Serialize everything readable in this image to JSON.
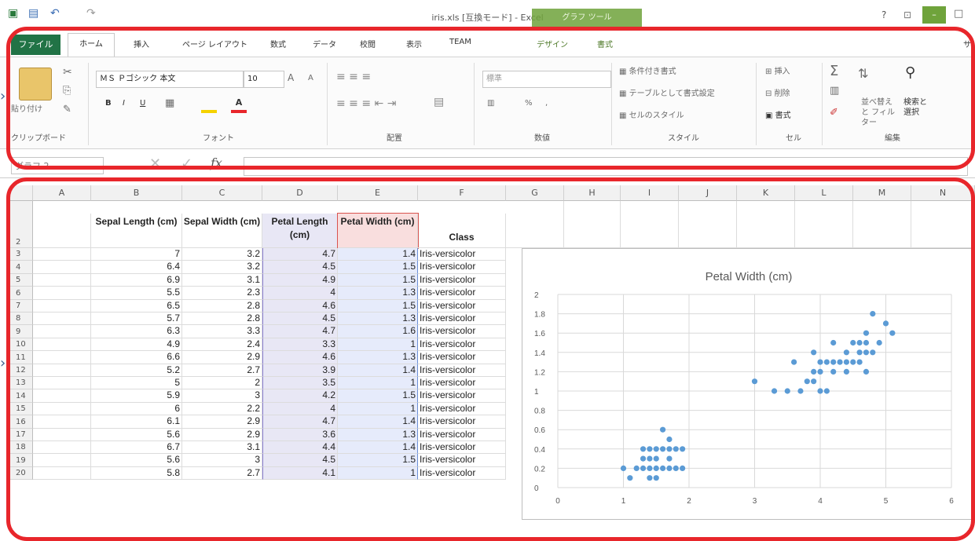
{
  "window": {
    "title": "iris.xls [互換モード] - Excel",
    "context_tab": "グラフ ツール",
    "help_label": "?"
  },
  "tabs": [
    "ファイル",
    "ホーム",
    "挿入",
    "ページ レイアウト",
    "数式",
    "データ",
    "校閲",
    "表示",
    "TEAM",
    "デザイン",
    "書式"
  ],
  "tab_overflow": "サ",
  "ribbon": {
    "clipboard": {
      "paste": "貼り付け",
      "group": "クリップボード"
    },
    "font": {
      "name": "ＭＳ Ｐゴシック 本文",
      "size": "10",
      "group": "フォント",
      "bold": "B",
      "italic": "I",
      "underline": "U",
      "grow": "A",
      "shrink": "A"
    },
    "alignment": {
      "group": "配置"
    },
    "number": {
      "format": "標準",
      "percent": "%",
      "comma": ",",
      "group": "数値"
    },
    "styles": {
      "conditional": "条件付き書式",
      "table": "テーブルとして書式設定",
      "cell_styles": "セルのスタイル",
      "group": "スタイル"
    },
    "cells": {
      "insert": "挿入",
      "delete": "削除",
      "format": "書式",
      "group": "セル"
    },
    "editing": {
      "sort": "並べ替えと フィルター",
      "find": "検索と 選択",
      "group": "編集"
    }
  },
  "formula_bar": {
    "name_box": "グラフ 2",
    "cancel": "✕",
    "enter": "✓",
    "fx": "fx"
  },
  "columns": [
    "A",
    "B",
    "C",
    "D",
    "E",
    "F",
    "G",
    "H",
    "I",
    "J",
    "K",
    "L",
    "M",
    "N"
  ],
  "headers": {
    "B": "Sepal Length (cm)",
    "C": "Sepal Width (cm)",
    "D": "Petal Length (cm)",
    "E": "Petal Width (cm)",
    "F": "Class"
  },
  "rows": [
    {
      "n": "3",
      "b": "7",
      "c": "3.2",
      "d": "4.7",
      "e": "1.4",
      "f": "Iris-versicolor"
    },
    {
      "n": "4",
      "b": "6.4",
      "c": "3.2",
      "d": "4.5",
      "e": "1.5",
      "f": "Iris-versicolor"
    },
    {
      "n": "5",
      "b": "6.9",
      "c": "3.1",
      "d": "4.9",
      "e": "1.5",
      "f": "Iris-versicolor"
    },
    {
      "n": "6",
      "b": "5.5",
      "c": "2.3",
      "d": "4",
      "e": "1.3",
      "f": "Iris-versicolor"
    },
    {
      "n": "7",
      "b": "6.5",
      "c": "2.8",
      "d": "4.6",
      "e": "1.5",
      "f": "Iris-versicolor"
    },
    {
      "n": "8",
      "b": "5.7",
      "c": "2.8",
      "d": "4.5",
      "e": "1.3",
      "f": "Iris-versicolor"
    },
    {
      "n": "9",
      "b": "6.3",
      "c": "3.3",
      "d": "4.7",
      "e": "1.6",
      "f": "Iris-versicolor"
    },
    {
      "n": "10",
      "b": "4.9",
      "c": "2.4",
      "d": "3.3",
      "e": "1",
      "f": "Iris-versicolor"
    },
    {
      "n": "11",
      "b": "6.6",
      "c": "2.9",
      "d": "4.6",
      "e": "1.3",
      "f": "Iris-versicolor"
    },
    {
      "n": "12",
      "b": "5.2",
      "c": "2.7",
      "d": "3.9",
      "e": "1.4",
      "f": "Iris-versicolor"
    },
    {
      "n": "13",
      "b": "5",
      "c": "2",
      "d": "3.5",
      "e": "1",
      "f": "Iris-versicolor"
    },
    {
      "n": "14",
      "b": "5.9",
      "c": "3",
      "d": "4.2",
      "e": "1.5",
      "f": "Iris-versicolor"
    },
    {
      "n": "15",
      "b": "6",
      "c": "2.2",
      "d": "4",
      "e": "1",
      "f": "Iris-versicolor"
    },
    {
      "n": "16",
      "b": "6.1",
      "c": "2.9",
      "d": "4.7",
      "e": "1.4",
      "f": "Iris-versicolor"
    },
    {
      "n": "17",
      "b": "5.6",
      "c": "2.9",
      "d": "3.6",
      "e": "1.3",
      "f": "Iris-versicolor"
    },
    {
      "n": "18",
      "b": "6.7",
      "c": "3.1",
      "d": "4.4",
      "e": "1.4",
      "f": "Iris-versicolor"
    },
    {
      "n": "19",
      "b": "5.6",
      "c": "3",
      "d": "4.5",
      "e": "1.5",
      "f": "Iris-versicolor"
    },
    {
      "n": "20",
      "b": "5.8",
      "c": "2.7",
      "d": "4.1",
      "e": "1",
      "f": "Iris-versicolor"
    }
  ],
  "chart_data": {
    "type": "scatter",
    "title": "Petal Width (cm)",
    "xlim": [
      0,
      6
    ],
    "ylim": [
      0,
      2
    ],
    "x_ticks": [
      "0",
      "1",
      "2",
      "3",
      "4",
      "5",
      "6"
    ],
    "y_ticks": [
      "0",
      "0.2",
      "0.4",
      "0.6",
      "0.8",
      "1",
      "1.2",
      "1.4",
      "1.6",
      "1.8",
      "2"
    ],
    "grid": true,
    "color": "#5b9bd5",
    "points": [
      [
        1.0,
        0.2
      ],
      [
        1.1,
        0.1
      ],
      [
        1.2,
        0.2
      ],
      [
        1.3,
        0.2
      ],
      [
        1.3,
        0.3
      ],
      [
        1.3,
        0.4
      ],
      [
        1.4,
        0.1
      ],
      [
        1.4,
        0.2
      ],
      [
        1.4,
        0.3
      ],
      [
        1.4,
        0.4
      ],
      [
        1.5,
        0.1
      ],
      [
        1.5,
        0.2
      ],
      [
        1.5,
        0.3
      ],
      [
        1.5,
        0.4
      ],
      [
        1.6,
        0.2
      ],
      [
        1.6,
        0.4
      ],
      [
        1.6,
        0.6
      ],
      [
        1.7,
        0.2
      ],
      [
        1.7,
        0.3
      ],
      [
        1.7,
        0.4
      ],
      [
        1.7,
        0.5
      ],
      [
        1.8,
        0.2
      ],
      [
        1.8,
        0.4
      ],
      [
        1.9,
        0.2
      ],
      [
        1.9,
        0.4
      ],
      [
        3.0,
        1.1
      ],
      [
        3.3,
        1.0
      ],
      [
        3.5,
        1.0
      ],
      [
        3.6,
        1.3
      ],
      [
        3.7,
        1.0
      ],
      [
        3.8,
        1.1
      ],
      [
        3.9,
        1.1
      ],
      [
        3.9,
        1.2
      ],
      [
        3.9,
        1.4
      ],
      [
        4.0,
        1.0
      ],
      [
        4.0,
        1.2
      ],
      [
        4.0,
        1.3
      ],
      [
        4.1,
        1.0
      ],
      [
        4.1,
        1.3
      ],
      [
        4.2,
        1.2
      ],
      [
        4.2,
        1.3
      ],
      [
        4.2,
        1.5
      ],
      [
        4.3,
        1.3
      ],
      [
        4.4,
        1.2
      ],
      [
        4.4,
        1.3
      ],
      [
        4.4,
        1.4
      ],
      [
        4.5,
        1.3
      ],
      [
        4.5,
        1.5
      ],
      [
        4.6,
        1.3
      ],
      [
        4.6,
        1.4
      ],
      [
        4.6,
        1.5
      ],
      [
        4.7,
        1.2
      ],
      [
        4.7,
        1.4
      ],
      [
        4.7,
        1.5
      ],
      [
        4.7,
        1.6
      ],
      [
        4.8,
        1.4
      ],
      [
        4.8,
        1.8
      ],
      [
        4.9,
        1.5
      ],
      [
        5.0,
        1.7
      ],
      [
        5.1,
        1.6
      ]
    ]
  }
}
